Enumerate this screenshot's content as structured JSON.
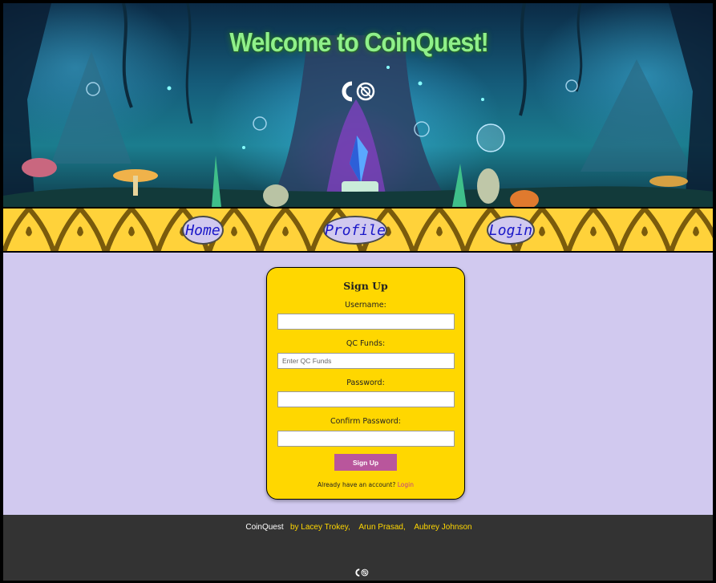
{
  "banner": {
    "title": "Welcome to CoinQuest!",
    "logo_icon": "coinquest-logo-icon"
  },
  "nav": {
    "items": [
      {
        "label": "Home"
      },
      {
        "label": "Profile"
      },
      {
        "label": "Login"
      }
    ]
  },
  "signup": {
    "title": "Sign Up",
    "username_label": "Username:",
    "username_value": "",
    "funds_label": "QC Funds:",
    "funds_placeholder": "Enter QC Funds",
    "password_label": "Password:",
    "confirm_label": "Confirm Password:",
    "submit_label": "Sign Up",
    "already_text": "Already have an account?",
    "login_link": "Login"
  },
  "footer": {
    "brand": "CoinQuest",
    "by": "by Lacey Trokey,",
    "author2": "Arun Prasad,",
    "author3": "Aubrey Johnson"
  },
  "colors": {
    "page_bg": "#d1c9ef",
    "nav_bg": "#ffd23a",
    "card_bg": "#ffd700",
    "button_bg": "#b9569c",
    "footer_bg": "#333333",
    "title_green": "#8ff08a"
  }
}
